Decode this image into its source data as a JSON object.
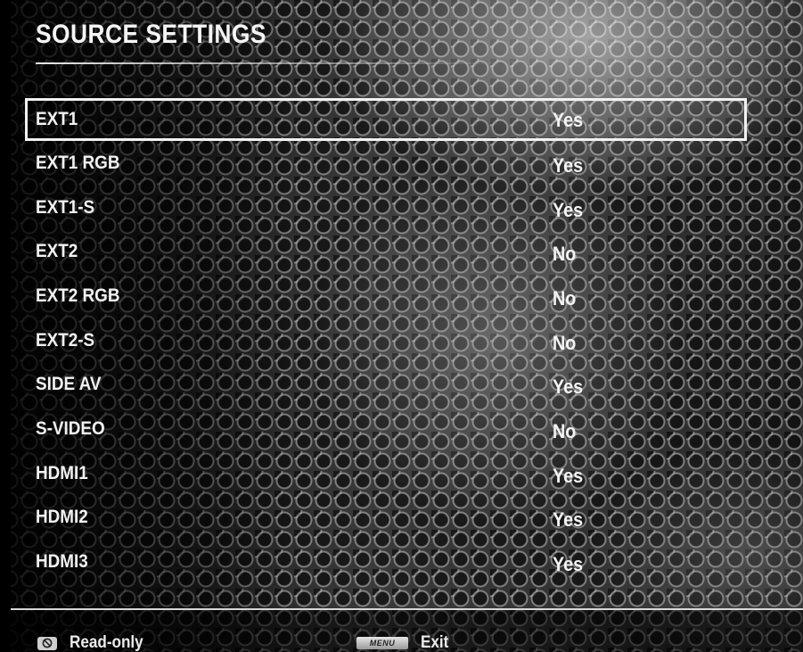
{
  "header": {
    "title": "SOURCE SETTINGS"
  },
  "sources": [
    {
      "label": "EXT1",
      "value": "Yes",
      "selected": true
    },
    {
      "label": "EXT1 RGB",
      "value": "Yes"
    },
    {
      "label": "EXT1-S",
      "value": "Yes"
    },
    {
      "label": "EXT2",
      "value": "No"
    },
    {
      "label": "EXT2 RGB",
      "value": "No"
    },
    {
      "label": "EXT2-S",
      "value": "No"
    },
    {
      "label": "SIDE AV",
      "value": "Yes"
    },
    {
      "label": "S-VIDEO",
      "value": "No"
    },
    {
      "label": "HDMI1",
      "value": "Yes"
    },
    {
      "label": "HDMI2",
      "value": "Yes"
    },
    {
      "label": "HDMI3",
      "value": "Yes"
    }
  ],
  "footer": {
    "readonly_icon": "no-entry-icon",
    "readonly_label": "Read-only",
    "menu_key_label": "MENU",
    "exit_label": "Exit"
  },
  "colors": {
    "text": "#f2f2f2",
    "background": "#1e1e1e",
    "selection_outline": "#f2f2f2"
  }
}
